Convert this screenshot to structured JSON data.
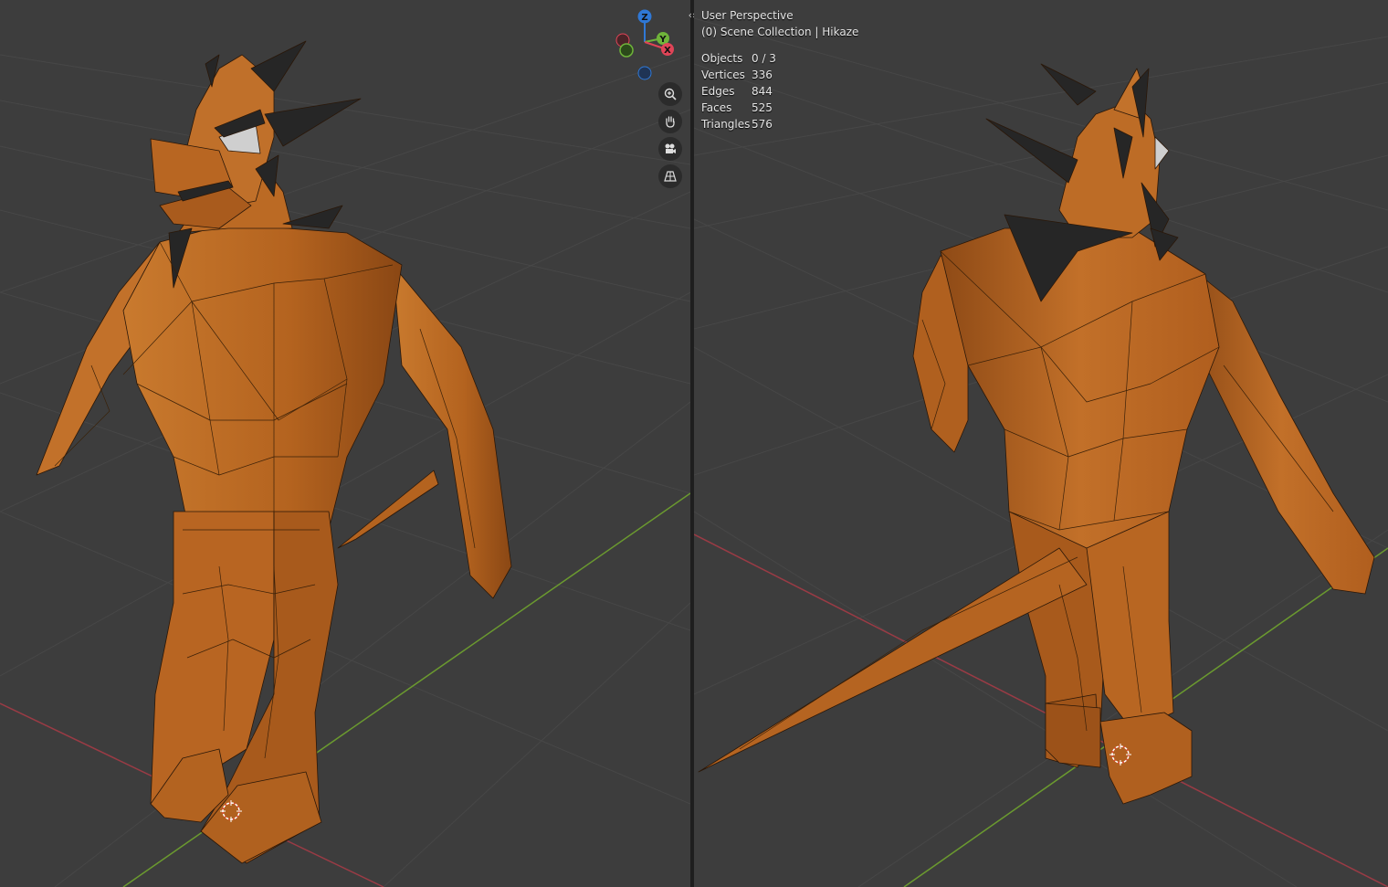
{
  "viewport_overlay": {
    "perspective_label": "User Perspective",
    "collection_label": "(0) Scene Collection | Hikaze"
  },
  "statistics": [
    {
      "label": "Objects",
      "value": "0 / 3"
    },
    {
      "label": "Vertices",
      "value": "336"
    },
    {
      "label": "Edges",
      "value": "844"
    },
    {
      "label": "Faces",
      "value": "525"
    },
    {
      "label": "Triangles",
      "value": "576"
    }
  ],
  "gizmo": {
    "axes": [
      {
        "label": "Z",
        "color": "#2f78d6"
      },
      {
        "label": "Y",
        "color": "#6fb43a"
      },
      {
        "label": "X",
        "color": "#e04457"
      }
    ]
  },
  "nav_tools": [
    {
      "icon": "zoom-icon"
    },
    {
      "icon": "pan-hand-icon"
    },
    {
      "icon": "camera-icon"
    },
    {
      "icon": "perspective-grid-icon"
    }
  ],
  "colors": {
    "viewport_bg": "#3d3d3d",
    "grid": "#464646",
    "x_axis": "#9a3b45",
    "y_axis": "#6b9a2f",
    "mesh": "#b4631f",
    "mesh_shadow": "#8a4714",
    "spikes": "#262626"
  }
}
